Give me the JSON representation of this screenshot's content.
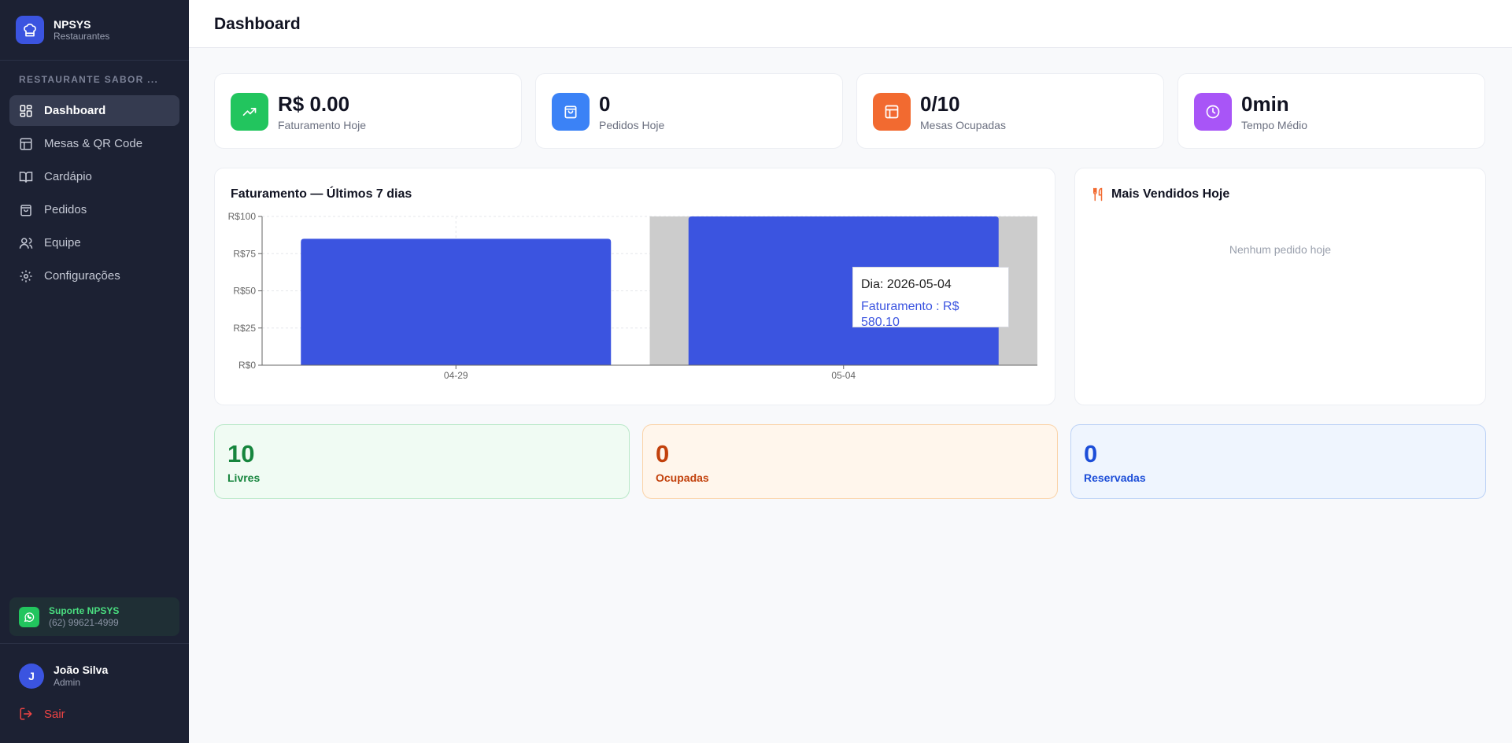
{
  "brand": {
    "name": "NPSYS",
    "subtitle": "Restaurantes"
  },
  "sidebar": {
    "restaurant_name": "RESTAURANTE SABOR ...",
    "items": [
      {
        "label": "Dashboard",
        "icon": "grid-icon",
        "active": true
      },
      {
        "label": "Mesas & QR Code",
        "icon": "table-icon",
        "active": false
      },
      {
        "label": "Cardápio",
        "icon": "book-icon",
        "active": false
      },
      {
        "label": "Pedidos",
        "icon": "bag-icon",
        "active": false
      },
      {
        "label": "Equipe",
        "icon": "users-icon",
        "active": false
      },
      {
        "label": "Configurações",
        "icon": "gear-icon",
        "active": false
      }
    ],
    "support": {
      "title": "Suporte NPSYS",
      "phone": "(62) 99621-4999"
    },
    "user": {
      "initial": "J",
      "name": "João Silva",
      "role": "Admin"
    },
    "logout_label": "Sair"
  },
  "header": {
    "title": "Dashboard"
  },
  "stats": [
    {
      "value": "R$ 0.00",
      "label": "Faturamento Hoje",
      "icon": "trending-up-icon",
      "color": "#22c55e"
    },
    {
      "value": "0",
      "label": "Pedidos Hoje",
      "icon": "shopping-bag-icon",
      "color": "#3b82f6"
    },
    {
      "value": "0/10",
      "label": "Mesas Ocupadas",
      "icon": "table-icon",
      "color": "#f26a30"
    },
    {
      "value": "0min",
      "label": "Tempo Médio",
      "icon": "clock-icon",
      "color": "#a855f7"
    }
  ],
  "chart": {
    "title": "Faturamento — Últimos 7 dias",
    "tooltip": {
      "line1": "Dia: 2026-05-04",
      "line2": "Faturamento : R$ 580.10"
    }
  },
  "chart_data": {
    "type": "bar",
    "categories": [
      "04-29",
      "05-04"
    ],
    "values": [
      85,
      580.1
    ],
    "ylim": [
      0,
      100
    ],
    "yticks": [
      "R$0",
      "R$25",
      "R$50",
      "R$75",
      "R$100"
    ],
    "ytick_values": [
      0,
      25,
      50,
      75,
      100
    ],
    "title": "Faturamento — Últimos 7 dias",
    "bar_color": "#3b54e0",
    "highlight_color": "#cccccc",
    "highlighted_category": "05-04",
    "grid": true
  },
  "top_sellers": {
    "title": "Mais Vendidos Hoje",
    "empty": "Nenhum pedido hoje"
  },
  "table_status": [
    {
      "value": "10",
      "label": "Livres",
      "color": "#16853d",
      "bg": "#f0fbf3",
      "border": "#b9e8c8"
    },
    {
      "value": "0",
      "label": "Ocupadas",
      "color": "#c2410c",
      "bg": "#fff6ec",
      "border": "#fad3a8"
    },
    {
      "value": "0",
      "label": "Reservadas",
      "color": "#1d4ed8",
      "bg": "#eff5fe",
      "border": "#bcd2f6"
    }
  ]
}
